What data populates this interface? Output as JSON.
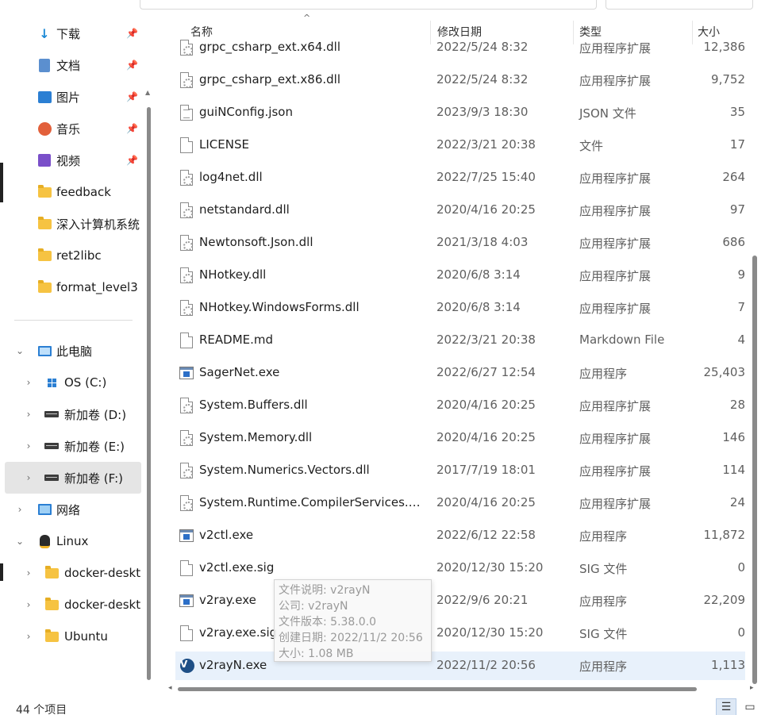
{
  "nav": {
    "quick": [
      {
        "label": "下载",
        "icon": "download-icon",
        "pinned": true
      },
      {
        "label": "文档",
        "icon": "documents-icon",
        "pinned": true
      },
      {
        "label": "图片",
        "icon": "pictures-icon",
        "pinned": true
      },
      {
        "label": "音乐",
        "icon": "music-icon",
        "pinned": true
      },
      {
        "label": "视频",
        "icon": "videos-icon",
        "pinned": true
      },
      {
        "label": "feedback",
        "icon": "folder-icon",
        "pinned": false
      },
      {
        "label": "深入计算机系统",
        "icon": "folder-icon",
        "pinned": false
      },
      {
        "label": "ret2libc",
        "icon": "folder-icon",
        "pinned": false
      },
      {
        "label": "format_level3",
        "icon": "folder-icon",
        "pinned": false
      }
    ],
    "this_pc": "此电脑",
    "drives": [
      {
        "label": "OS (C:)",
        "icon": "windows-drive-icon"
      },
      {
        "label": "新加卷 (D:)",
        "icon": "drive-icon"
      },
      {
        "label": "新加卷 (E:)",
        "icon": "drive-icon"
      },
      {
        "label": "新加卷 (F:)",
        "icon": "drive-icon"
      }
    ],
    "network": "网络",
    "linux": "Linux",
    "linux_children": [
      "docker-deskt",
      "docker-deskt",
      "Ubuntu"
    ]
  },
  "header": {
    "name": "名称",
    "date": "修改日期",
    "type": "类型",
    "size": "大小"
  },
  "files": [
    {
      "name": "grpc_csharp_ext.x64.dll",
      "date": "2022/5/24 8:32",
      "type": "应用程序扩展",
      "size": "12,386",
      "icon": "dll"
    },
    {
      "name": "grpc_csharp_ext.x86.dll",
      "date": "2022/5/24 8:32",
      "type": "应用程序扩展",
      "size": "9,752",
      "icon": "dll"
    },
    {
      "name": "guiNConfig.json",
      "date": "2023/9/3 18:30",
      "type": "JSON 文件",
      "size": "35",
      "icon": "json"
    },
    {
      "name": "LICENSE",
      "date": "2022/3/21 20:38",
      "type": "文件",
      "size": "17",
      "icon": "doc"
    },
    {
      "name": "log4net.dll",
      "date": "2022/7/25 15:40",
      "type": "应用程序扩展",
      "size": "264",
      "icon": "dll"
    },
    {
      "name": "netstandard.dll",
      "date": "2020/4/16 20:25",
      "type": "应用程序扩展",
      "size": "97",
      "icon": "dll"
    },
    {
      "name": "Newtonsoft.Json.dll",
      "date": "2021/3/18 4:03",
      "type": "应用程序扩展",
      "size": "686",
      "icon": "dll"
    },
    {
      "name": "NHotkey.dll",
      "date": "2020/6/8 3:14",
      "type": "应用程序扩展",
      "size": "9",
      "icon": "dll"
    },
    {
      "name": "NHotkey.WindowsForms.dll",
      "date": "2020/6/8 3:14",
      "type": "应用程序扩展",
      "size": "7",
      "icon": "dll"
    },
    {
      "name": "README.md",
      "date": "2022/3/21 20:38",
      "type": "Markdown File",
      "size": "4",
      "icon": "doc"
    },
    {
      "name": "SagerNet.exe",
      "date": "2022/6/27 12:54",
      "type": "应用程序",
      "size": "25,403",
      "icon": "exe"
    },
    {
      "name": "System.Buffers.dll",
      "date": "2020/4/16 20:25",
      "type": "应用程序扩展",
      "size": "28",
      "icon": "dll"
    },
    {
      "name": "System.Memory.dll",
      "date": "2020/4/16 20:25",
      "type": "应用程序扩展",
      "size": "146",
      "icon": "dll"
    },
    {
      "name": "System.Numerics.Vectors.dll",
      "date": "2017/7/19 18:01",
      "type": "应用程序扩展",
      "size": "114",
      "icon": "dll"
    },
    {
      "name": "System.Runtime.CompilerServices.U...",
      "date": "2020/4/16 20:25",
      "type": "应用程序扩展",
      "size": "24",
      "icon": "dll"
    },
    {
      "name": "v2ctl.exe",
      "date": "2022/6/12 22:58",
      "type": "应用程序",
      "size": "11,872",
      "icon": "exe"
    },
    {
      "name": "v2ctl.exe.sig",
      "date": "2020/12/30 15:20",
      "type": "SIG 文件",
      "size": "0",
      "icon": "doc"
    },
    {
      "name": "v2ray.exe",
      "date": "2022/9/6 20:21",
      "type": "应用程序",
      "size": "22,209",
      "icon": "exe"
    },
    {
      "name": "v2ray.exe.sig",
      "date": "2020/12/30 15:20",
      "type": "SIG 文件",
      "size": "0",
      "icon": "doc"
    },
    {
      "name": "v2rayN.exe",
      "date": "2022/11/2 20:56",
      "type": "应用程序",
      "size": "1,113",
      "icon": "v2rayn"
    }
  ],
  "tooltip": [
    "文件说明: v2rayN",
    "公司: v2rayN",
    "文件版本: 5.38.0.0",
    "创建日期: 2022/11/2 20:56",
    "大小: 1.08 MB"
  ],
  "status": {
    "item_count": "44 个项目"
  }
}
